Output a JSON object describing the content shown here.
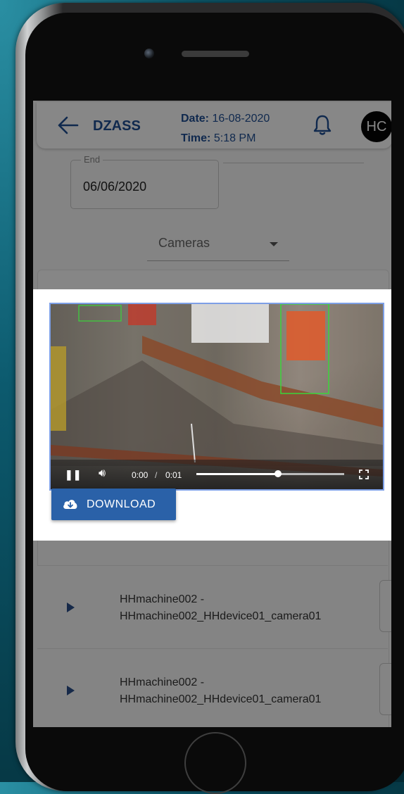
{
  "header": {
    "app_name": "DZASS",
    "date_label": "Date:",
    "date_value": "16-08-2020",
    "time_label": "Time:",
    "time_value": "5:18 PM",
    "avatar_initials": "HC"
  },
  "filters": {
    "end_label": "End",
    "end_value": "06/06/2020",
    "camera_select": "Cameras"
  },
  "video": {
    "current_time": "0:00",
    "separator": "/",
    "duration": "0:01",
    "progress": 0.55
  },
  "download_label": "DOWNLOAD",
  "recordings": [
    {
      "line1": "HHmachine002 -",
      "line2": "HHmachine002_HHdevice01_camera01"
    },
    {
      "line1": "HHmachine002 -",
      "line2": "HHmachine002_HHdevice01_camera01"
    }
  ],
  "colors": {
    "brand": "#1f4f93",
    "download": "#2a61a8",
    "player_border": "#7d9fe6"
  }
}
